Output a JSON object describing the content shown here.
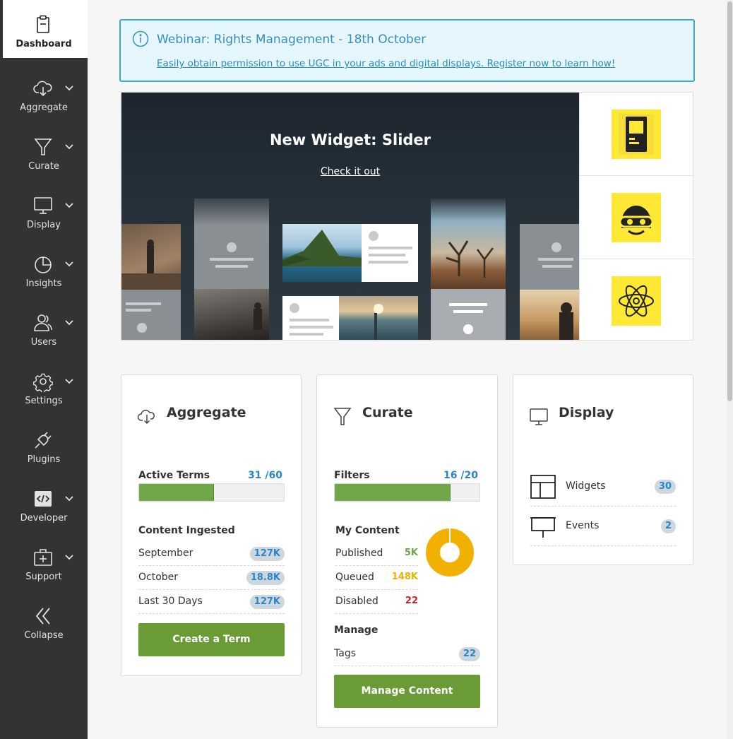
{
  "sidebar": {
    "items": [
      {
        "label": "Dashboard",
        "icon": "clipboard-icon",
        "active": true
      },
      {
        "label": "Aggregate",
        "icon": "cloud-download-icon",
        "chevron": true
      },
      {
        "label": "Curate",
        "icon": "funnel-icon",
        "chevron": true
      },
      {
        "label": "Display",
        "icon": "monitor-icon",
        "chevron": true
      },
      {
        "label": "Insights",
        "icon": "pie-chart-icon",
        "chevron": true
      },
      {
        "label": "Users",
        "icon": "users-icon",
        "chevron": true
      },
      {
        "label": "Settings",
        "icon": "gear-icon",
        "chevron": true
      },
      {
        "label": "Plugins",
        "icon": "plug-icon",
        "chevron": false
      },
      {
        "label": "Developer",
        "icon": "code-icon",
        "chevron": true
      },
      {
        "label": "Support",
        "icon": "first-aid-icon",
        "chevron": true
      },
      {
        "label": "Collapse",
        "icon": "double-chevron-left-icon",
        "chevron": false
      }
    ]
  },
  "banner": {
    "title": "Webinar: Rights Management - 18th October",
    "link": "Easily obtain permission to use UGC in your ads and digital displays. Register now to learn how!",
    "icon": "info-icon"
  },
  "hero": {
    "title": "New Widget: Slider",
    "link": "Check it out",
    "side_icons": [
      "tablet-icon",
      "pilot-helmet-icon",
      "atom-icon"
    ]
  },
  "aggregate": {
    "title": "Aggregate",
    "meter_label": "Active Terms",
    "meter_value": "31 /60",
    "meter_fraction": 0.517,
    "section": "Content Ingested",
    "rows": [
      {
        "label": "September",
        "value": "127K"
      },
      {
        "label": "October",
        "value": "18.8K"
      },
      {
        "label": "Last 30 Days",
        "value": "127K"
      }
    ],
    "button": "Create a Term"
  },
  "curate": {
    "title": "Curate",
    "meter_label": "Filters",
    "meter_value": "16 /20",
    "meter_fraction": 0.8,
    "section": "My Content",
    "rows": [
      {
        "label": "Published",
        "value": "5K",
        "color": "#6ea648"
      },
      {
        "label": "Queued",
        "value": "148K",
        "color": "#f2b100"
      },
      {
        "label": "Disabled",
        "value": "22",
        "color": "#cc2030"
      }
    ],
    "manage_heading": "Manage",
    "tags_label": "Tags",
    "tags_value": "22",
    "button": "Manage Content",
    "donut_fraction_queued": 0.97
  },
  "display": {
    "title": "Display",
    "rows": [
      {
        "label": "Widgets",
        "value": "30",
        "icon": "layout-icon"
      },
      {
        "label": "Events",
        "value": "2",
        "icon": "billboard-icon"
      }
    ]
  },
  "colors": {
    "sidebar_bg": "#333333",
    "accent_green": "#6a9b37",
    "link_blue": "#2a86c6",
    "banner_bg": "#e5f7fd"
  }
}
